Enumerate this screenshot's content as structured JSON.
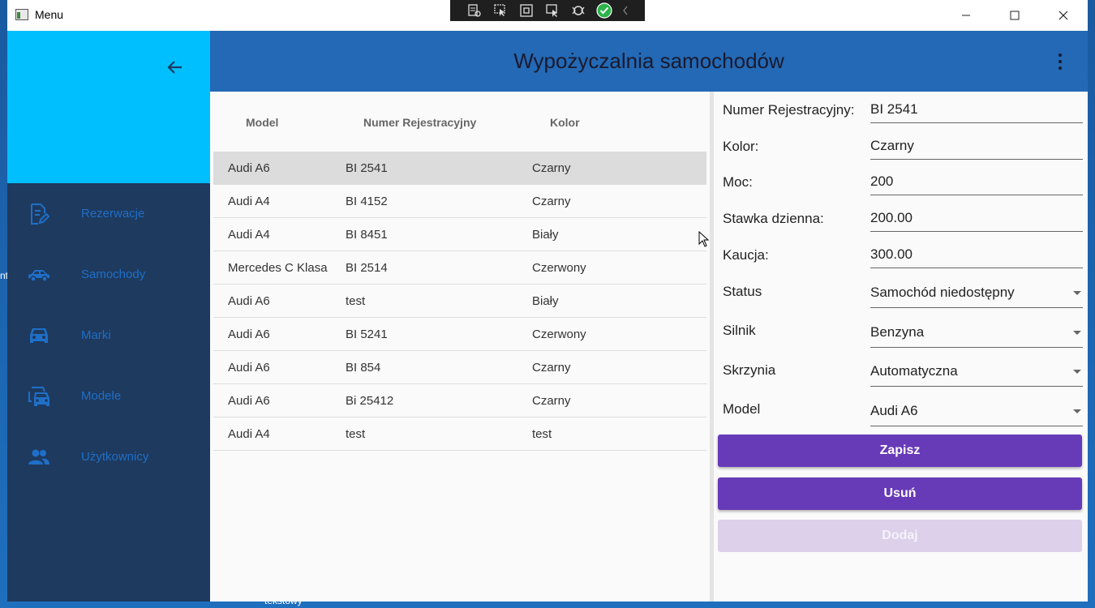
{
  "window": {
    "title": "Menu"
  },
  "desktop": {
    "label": "tekstowy",
    "edge_label": "nt"
  },
  "appbar": {
    "title": "Wypożyczalnia samochodów"
  },
  "sidebar": {
    "items": [
      {
        "label": "Rezerwacje",
        "icon": "edit-document-icon"
      },
      {
        "label": "Samochody",
        "icon": "car-side-icon"
      },
      {
        "label": "Marki",
        "icon": "car-front-icon"
      },
      {
        "label": "Modele",
        "icon": "cars-icon"
      },
      {
        "label": "Użytkownicy",
        "icon": "users-icon"
      }
    ]
  },
  "table": {
    "headers": [
      "Model",
      "Numer Rejestracyjny",
      "Kolor"
    ],
    "rows": [
      [
        "Audi A6",
        "BI 2541",
        "Czarny"
      ],
      [
        "Audi A4",
        "BI 4152",
        "Czarny"
      ],
      [
        "Audi A4",
        "BI 8451",
        "Biały"
      ],
      [
        "Mercedes C Klasa",
        "BI 2514",
        "Czerwony"
      ],
      [
        "Audi A6",
        "test",
        "Biały"
      ],
      [
        "Audi A6",
        "BI 5241",
        "Czerwony"
      ],
      [
        "Audi A6",
        "BI 854",
        "Czarny"
      ],
      [
        "Audi A6",
        "Bi 25412",
        "Czarny"
      ],
      [
        "Audi A4",
        "test",
        "test"
      ]
    ],
    "selected_row": 0
  },
  "form": {
    "fields": [
      {
        "label": "Numer Rejestracyjny:",
        "value": "BI 2541"
      },
      {
        "label": "Kolor:",
        "value": "Czarny"
      },
      {
        "label": "Moc:",
        "value": "200"
      },
      {
        "label": "Stawka dzienna:",
        "value": "200.00"
      },
      {
        "label": "Kaucja:",
        "value": "300.00"
      }
    ],
    "selects": [
      {
        "label": "Status",
        "value": "Samochód niedostępny"
      },
      {
        "label": "Silnik",
        "value": "Benzyna"
      },
      {
        "label": "Skrzynia",
        "value": "Automatyczna"
      },
      {
        "label": "Model",
        "value": "Audi A6"
      }
    ],
    "buttons": {
      "save": "Zapisz",
      "delete": "Usuń",
      "add": "Dodaj"
    }
  },
  "colors": {
    "sidebar_top": "#00bfff",
    "sidebar": "#1e3a5f",
    "appbar": "#2369b5",
    "button": "#673ab7",
    "nav_text": "#1f6fc7"
  }
}
